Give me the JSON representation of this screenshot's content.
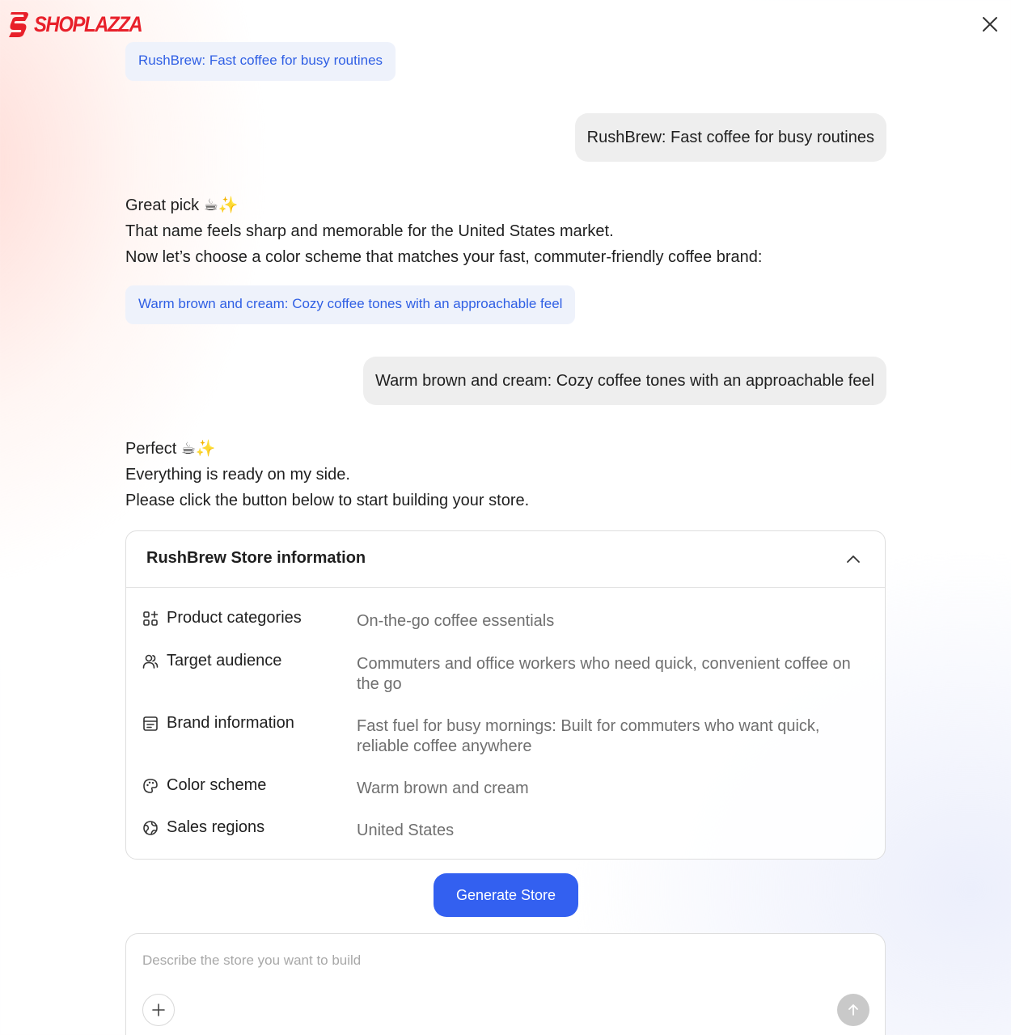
{
  "brand": {
    "name": "SHOPLAZZA",
    "color": "#e8202a"
  },
  "header": {
    "close_icon": "close-icon"
  },
  "conversation": {
    "top_suggestion": "RushBrew: Fast coffee for busy routines",
    "user_message_1": "RushBrew: Fast coffee for busy routines",
    "bot_message_1": {
      "line1": "Great pick ☕✨",
      "line2": "That name feels sharp and memorable for the United States market.",
      "line3": "Now let’s choose a color scheme that matches your fast, commuter-friendly coffee brand:"
    },
    "color_suggestion": "Warm brown and cream: Cozy coffee tones with an approachable feel",
    "user_message_2": "Warm brown and cream: Cozy coffee tones with an approachable feel",
    "bot_message_2": {
      "line1": "Perfect ☕✨",
      "line2": "Everything is ready on my side.",
      "line3": "Please click the button below to start building your store."
    }
  },
  "store_card": {
    "title": "RushBrew Store information",
    "rows": [
      {
        "icon": "grid-plus-icon",
        "label": "Product categories",
        "value": "On-the-go coffee essentials"
      },
      {
        "icon": "users-icon",
        "label": "Target audience",
        "value": "Commuters and office workers who need quick, convenient coffee on the go"
      },
      {
        "icon": "brand-card-icon",
        "label": "Brand information",
        "value": "Fast fuel for busy mornings: Built for commuters who want quick, reliable coffee anywhere"
      },
      {
        "icon": "palette-icon",
        "label": "Color scheme",
        "value": "Warm brown and cream"
      },
      {
        "icon": "globe-icon",
        "label": "Sales regions",
        "value": "United States"
      }
    ]
  },
  "actions": {
    "generate_label": "Generate Store",
    "accent_color": "#3360f0"
  },
  "composer": {
    "placeholder": "Describe the store you want to build",
    "value": ""
  }
}
